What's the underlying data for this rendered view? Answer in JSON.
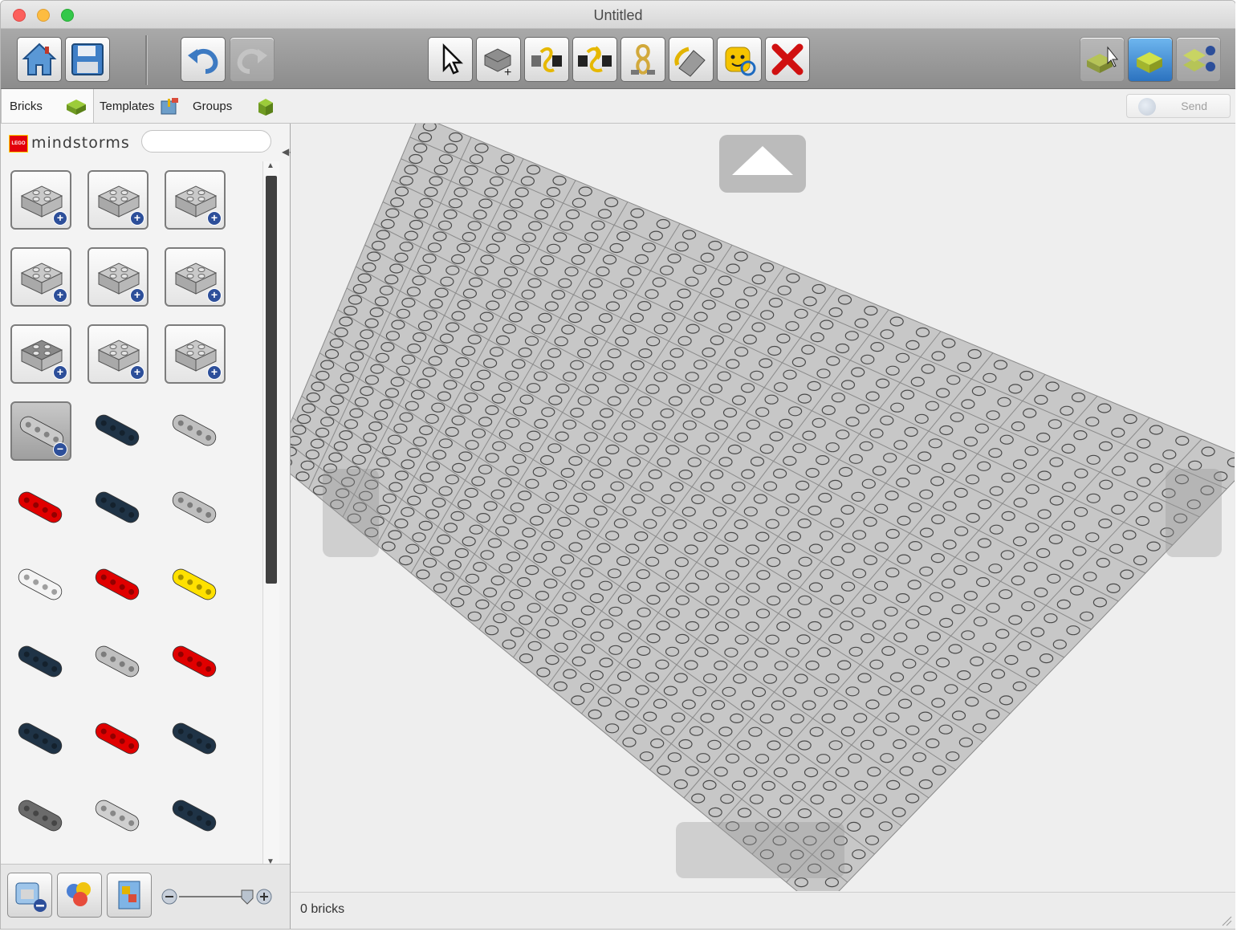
{
  "window": {
    "title": "Untitled"
  },
  "toolbar": {
    "buttons": [
      {
        "id": "home",
        "icon": "home-icon"
      },
      {
        "id": "save",
        "icon": "save-icon"
      },
      {
        "id": "undo",
        "icon": "undo-icon"
      },
      {
        "id": "redo",
        "icon": "redo-icon",
        "disabled": true
      },
      {
        "id": "select",
        "icon": "cursor-icon"
      },
      {
        "id": "clone",
        "icon": "clone-brick-icon"
      },
      {
        "id": "hinge",
        "icon": "hinge-icon"
      },
      {
        "id": "hinge-align",
        "icon": "hinge-align-icon"
      },
      {
        "id": "flex",
        "icon": "flex-icon"
      },
      {
        "id": "paint",
        "icon": "paint-bucket-icon"
      },
      {
        "id": "hide",
        "icon": "minifig-hide-icon"
      },
      {
        "id": "delete",
        "icon": "delete-icon"
      },
      {
        "id": "build-mode",
        "icon": "build-mode-icon"
      },
      {
        "id": "view-mode",
        "icon": "view-mode-icon"
      },
      {
        "id": "building-guide",
        "icon": "building-guide-icon"
      }
    ]
  },
  "tabs": [
    {
      "label": "Bricks",
      "active": true
    },
    {
      "label": "Templates",
      "active": false
    },
    {
      "label": "Groups",
      "active": false
    }
  ],
  "send": {
    "label": "Send"
  },
  "palette": {
    "brand": "mindstorms",
    "search": {
      "value": "",
      "placeholder": ""
    },
    "items": [
      {
        "name": "brick-2x2-gray",
        "kind": "group",
        "color": "#c9c9c9"
      },
      {
        "name": "round-brick-gray",
        "kind": "group",
        "color": "#c9c9c9"
      },
      {
        "name": "technic-brick-gray",
        "kind": "group",
        "color": "#c9c9c9"
      },
      {
        "name": "plate-2x2-gray",
        "kind": "group",
        "color": "#c9c9c9"
      },
      {
        "name": "wedge-plate-gray",
        "kind": "group",
        "color": "#c9c9c9"
      },
      {
        "name": "hinge-plate-gray",
        "kind": "group",
        "color": "#c9c9c9"
      },
      {
        "name": "wheel-gray",
        "kind": "group",
        "color": "#8a8a8a"
      },
      {
        "name": "axle-connector-gray",
        "kind": "group",
        "color": "#c9c9c9"
      },
      {
        "name": "technic-beam-gray",
        "kind": "group",
        "color": "#c9c9c9"
      },
      {
        "name": "liftarm-gray-open",
        "kind": "expanded",
        "color": "#c9c9c9"
      },
      {
        "name": "liftarm-dark-blue",
        "kind": "part",
        "color": "#1f3346"
      },
      {
        "name": "liftarm-light-gray",
        "kind": "part",
        "color": "#bfbfbf"
      },
      {
        "name": "liftarm-red",
        "kind": "part",
        "color": "#e00000"
      },
      {
        "name": "liftarm-dark-blue-2",
        "kind": "part",
        "color": "#1f3346"
      },
      {
        "name": "liftarm-light-gray-2",
        "kind": "part",
        "color": "#bfbfbf"
      },
      {
        "name": "liftarm-white",
        "kind": "part",
        "color": "#f4f4f4"
      },
      {
        "name": "liftarm-red-2",
        "kind": "part",
        "color": "#e00000"
      },
      {
        "name": "liftarm-yellow",
        "kind": "part",
        "color": "#ffe100"
      },
      {
        "name": "liftarm-dark-blue-3",
        "kind": "part",
        "color": "#1f3346"
      },
      {
        "name": "liftarm-light-gray-3",
        "kind": "part",
        "color": "#bfbfbf"
      },
      {
        "name": "liftarm-red-3",
        "kind": "part",
        "color": "#e00000"
      },
      {
        "name": "liftarm-dark-blue-4",
        "kind": "part",
        "color": "#1f3346"
      },
      {
        "name": "liftarm-red-4",
        "kind": "part",
        "color": "#e00000"
      },
      {
        "name": "liftarm-dark-blue-5",
        "kind": "part",
        "color": "#1f3346"
      },
      {
        "name": "liftarm-dark-gray",
        "kind": "part",
        "color": "#6b6b6b"
      },
      {
        "name": "liftarm-light-gray-4",
        "kind": "part",
        "color": "#cfcfcf"
      },
      {
        "name": "liftarm-dark-blue-6",
        "kind": "part",
        "color": "#1f3346"
      }
    ]
  },
  "status": {
    "text": "0 bricks"
  },
  "colors": {
    "baseplate": "#c7c7c7",
    "stud": "#4a4a4a",
    "accent": "#2d4f9a"
  }
}
